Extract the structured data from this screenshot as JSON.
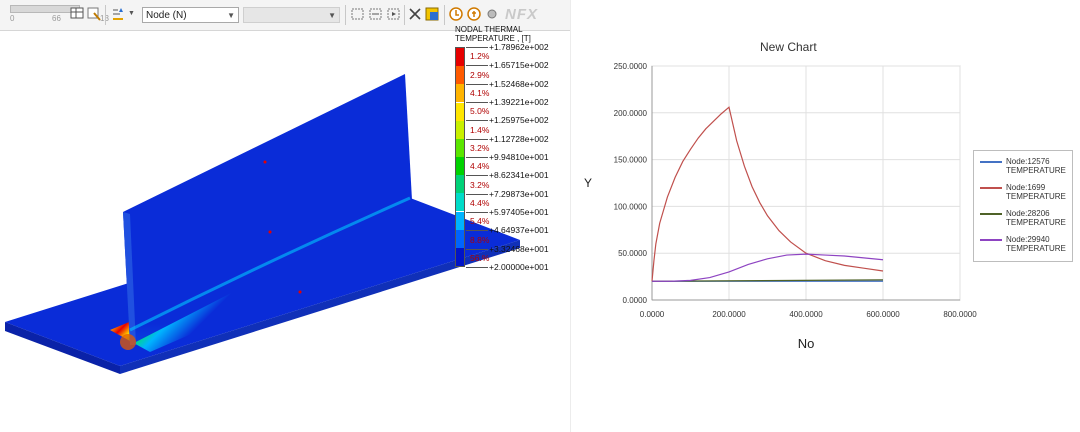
{
  "toolbar": {
    "slider_ticks": [
      "0",
      "66",
      "13"
    ],
    "result_type_select": "Node (N)",
    "component_select": "",
    "brand": "NFX"
  },
  "contour_legend": {
    "title": "NODAL THERMAL\nTEMPERATURE , [T]",
    "levels": [
      "+1.78962e+002",
      "+1.65715e+002",
      "+1.52468e+002",
      "+1.39221e+002",
      "+1.25975e+002",
      "+1.12728e+002",
      "+9.94810e+001",
      "+8.62341e+001",
      "+7.29873e+001",
      "+5.97405e+001",
      "+4.64937e+001",
      "+3.32468e+001",
      "+2.00000e+001"
    ],
    "percentages": [
      "1.2%",
      "2.9%",
      "4.1%",
      "5.0%",
      "1.4%",
      "3.2%",
      "4.4%",
      "3.2%",
      "4.4%",
      "5.4%",
      "8.8%",
      "56.%"
    ],
    "colors": [
      "#e60000",
      "#ff5a00",
      "#ffb400",
      "#ffe600",
      "#c8f000",
      "#5ae600",
      "#00d200",
      "#00d278",
      "#00dcc8",
      "#00b4ff",
      "#0064ff",
      "#0014c8"
    ]
  },
  "chart_data": {
    "type": "line",
    "title": "New Chart",
    "xlabel": "No",
    "ylabel": "Y",
    "xlim": [
      0,
      800
    ],
    "ylim": [
      0,
      250
    ],
    "x_ticks": [
      "0.0000",
      "200.0000",
      "400.0000",
      "600.0000",
      "800.0000"
    ],
    "y_ticks": [
      "0.0000",
      "50.0000",
      "100.0000",
      "150.0000",
      "200.0000",
      "250.0000"
    ],
    "grid": true,
    "legend_position": "right",
    "series": [
      {
        "name": "Node:12576\nTEMPERATURE",
        "color": "#4472c4",
        "x": [
          0,
          600
        ],
        "y": [
          20,
          20
        ]
      },
      {
        "name": "Node:1699\nTEMPERATURE",
        "color": "#c0504d",
        "x": [
          0,
          5,
          10,
          20,
          40,
          60,
          80,
          100,
          120,
          140,
          160,
          180,
          200,
          220,
          240,
          260,
          280,
          300,
          330,
          360,
          400,
          450,
          500,
          550,
          600
        ],
        "y": [
          20,
          42,
          60,
          82,
          110,
          131,
          148,
          161,
          173,
          183,
          191,
          199,
          206,
          170,
          143,
          121,
          104,
          90,
          74,
          62,
          50,
          42,
          37,
          34,
          31
        ]
      },
      {
        "name": "Node:28206\nTEMPERATURE",
        "color": "#4f6228",
        "x": [
          0,
          600
        ],
        "y": [
          20,
          21.5
        ]
      },
      {
        "name": "Node:29940\nTEMPERATURE",
        "color": "#8e44c2",
        "x": [
          0,
          50,
          100,
          150,
          200,
          250,
          300,
          350,
          400,
          450,
          500,
          550,
          600
        ],
        "y": [
          20,
          20,
          21,
          24,
          30,
          38,
          44,
          48,
          49,
          48,
          47,
          45,
          43
        ]
      }
    ]
  }
}
